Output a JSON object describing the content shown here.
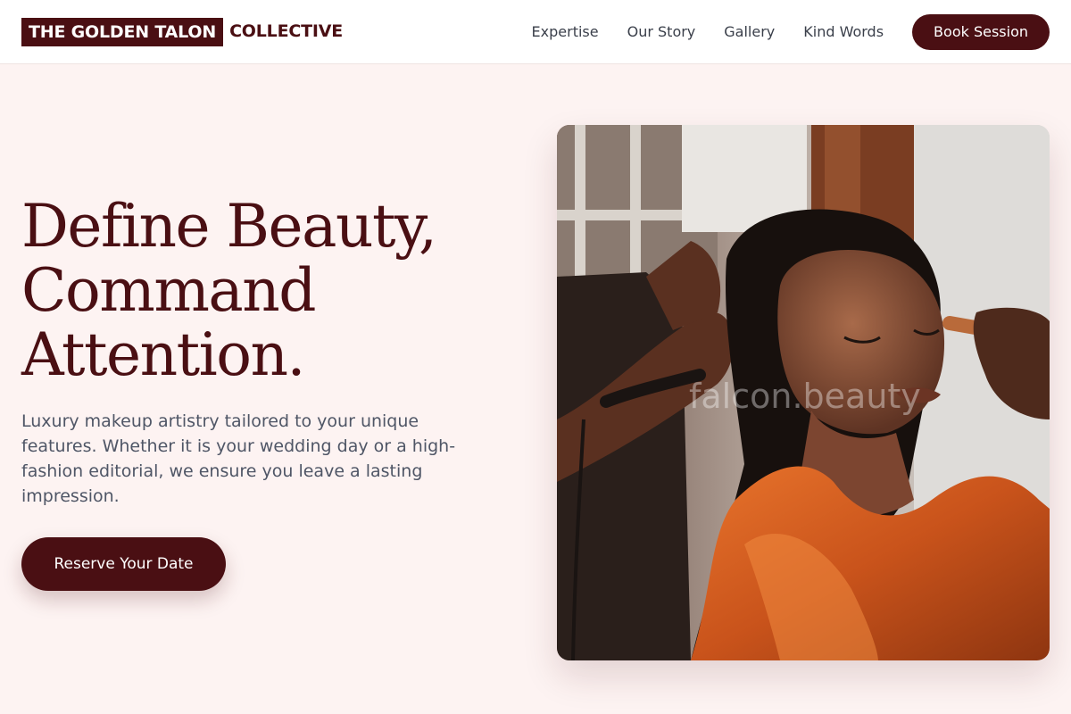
{
  "header": {
    "logo_highlight": "THE GOLDEN TALON",
    "logo_rest": "COLLECTIVE",
    "nav": [
      {
        "label": "Expertise"
      },
      {
        "label": "Our Story"
      },
      {
        "label": "Gallery"
      },
      {
        "label": "Kind Words"
      }
    ],
    "cta_label": "Book Session"
  },
  "hero": {
    "title_lines": [
      "Define Beauty,",
      "Command",
      "Attention."
    ],
    "subtitle": "Luxury makeup artistry tailored to your unique features. Whether it is your wedding day or a high-fashion editorial, we ensure you leave a lasting impression.",
    "cta_label": "Reserve Your Date",
    "image": {
      "watermark": "falcon.beauty",
      "icon": "photo-makeup-session"
    }
  },
  "colors": {
    "brand": "#4a0f13",
    "background": "#fdf3f2",
    "body_text": "#4f5666",
    "nav_text": "#3a3f4a"
  }
}
